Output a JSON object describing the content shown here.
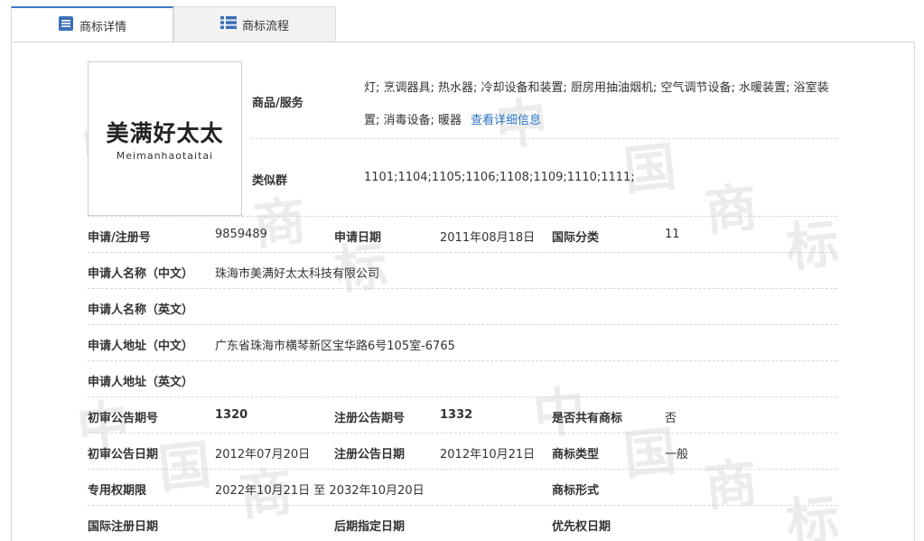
{
  "tabs": [
    {
      "label": "商标详情",
      "icon": "document-list-icon"
    },
    {
      "label": "商标流程",
      "icon": "grid-list-icon"
    }
  ],
  "watermark": {
    "chars": [
      "中",
      "国",
      "商",
      "标"
    ]
  },
  "logo": {
    "cn": "美满好太太",
    "en": "Meimanhaotaitai"
  },
  "goods": {
    "label": "商品/服务",
    "text": "灯; 烹调器具; 热水器; 冷却设备和装置; 厨房用抽油烟机; 空气调节设备; 水暖装置; 浴室装置; 消毒设备; 暖器",
    "link": "查看详细信息"
  },
  "similar": {
    "label": "类似群",
    "value": "1101;1104;1105;1106;1108;1109;1110;1111;"
  },
  "fields": {
    "reg_no": {
      "label": "申请/注册号",
      "value": "9859489"
    },
    "apply_date": {
      "label": "申请日期",
      "value": "2011年08月18日"
    },
    "intl_class": {
      "label": "国际分类",
      "value": "11"
    },
    "applicant_cn": {
      "label": "申请人名称（中文）",
      "value": "珠海市美满好太太科技有限公司"
    },
    "applicant_en": {
      "label": "申请人名称（英文）",
      "value": ""
    },
    "address_cn": {
      "label": "申请人地址（中文）",
      "value": "广东省珠海市横琴新区宝华路6号105室-6765"
    },
    "address_en": {
      "label": "申请人地址（英文）",
      "value": ""
    },
    "prelim_issue": {
      "label": "初审公告期号",
      "value": "1320"
    },
    "reg_issue": {
      "label": "注册公告期号",
      "value": "1332"
    },
    "shared": {
      "label": "是否共有商标",
      "value": "否"
    },
    "prelim_date": {
      "label": "初审公告日期",
      "value": "2012年07月20日"
    },
    "reg_date": {
      "label": "注册公告日期",
      "value": "2012年10月21日"
    },
    "tm_type": {
      "label": "商标类型",
      "value": "一般"
    },
    "term": {
      "label": "专用权期限",
      "value": "2022年10月21日 至 2032年10月20日"
    },
    "tm_form": {
      "label": "商标形式",
      "value": ""
    },
    "intl_reg_date": {
      "label": "国际注册日期",
      "value": ""
    },
    "later_date": {
      "label": "后期指定日期",
      "value": ""
    },
    "priority_date": {
      "label": "优先权日期",
      "value": ""
    }
  }
}
